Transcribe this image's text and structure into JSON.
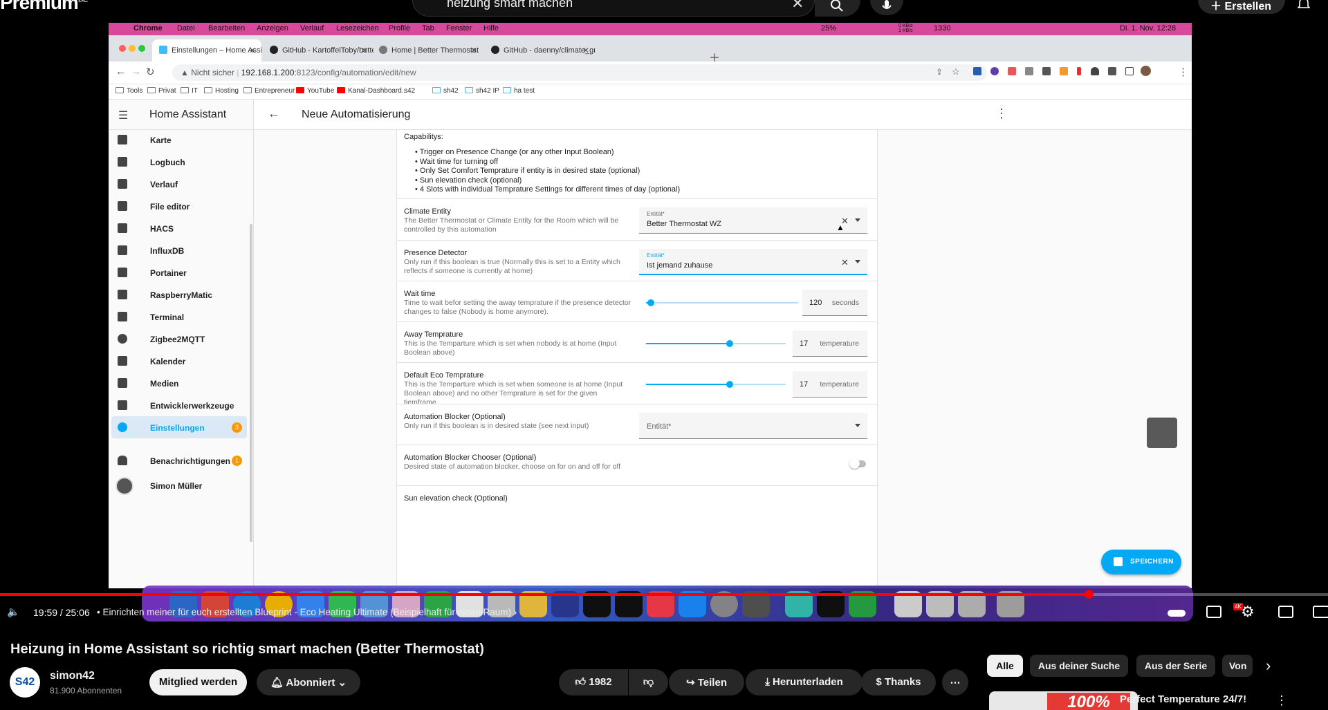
{
  "yt_header": {
    "logo": "Premium",
    "logo_region": "DE",
    "search_query": "heizung smart machen",
    "create_label": "Erstellen"
  },
  "mac_menubar": {
    "app": "Chrome",
    "items": [
      "Datei",
      "Bearbeiten",
      "Anzeigen",
      "Verlauf",
      "Lesezeichen",
      "Profile",
      "Tab",
      "Fenster",
      "Hilfe"
    ],
    "battery": "25%",
    "net_up": "0 KB/s",
    "net_down": "1 KB/s",
    "counter": "1330",
    "datetime": "Di. 1. Nov. 12:28"
  },
  "browser": {
    "tabs": [
      {
        "label": "Einstellungen – Home Assistant",
        "active": true
      },
      {
        "label": "GitHub - KartoffelToby/better_",
        "active": false
      },
      {
        "label": "Home | Better Thermostat",
        "active": false
      },
      {
        "label": "GitHub - daenny/climate_grou",
        "active": false
      }
    ],
    "security": "Nicht sicher",
    "url_host": "192.168.1.200",
    "url_path": ":8123/config/automation/edit/new",
    "bookmarks": [
      "Tools",
      "Privat",
      "IT",
      "Hosting",
      "Entrepreneur",
      "YouTube",
      "Kanal-Dashboard...",
      "s42",
      "sh42",
      "sh42 IP",
      "ha test"
    ]
  },
  "ha": {
    "app_title": "Home Assistant",
    "page_title": "Neue Automatisierung",
    "sidebar": [
      {
        "label": "Karte",
        "icon": "map-icon"
      },
      {
        "label": "Logbuch",
        "icon": "list-icon"
      },
      {
        "label": "Verlauf",
        "icon": "chart-icon"
      },
      {
        "label": "File editor",
        "icon": "wrench-icon"
      },
      {
        "label": "HACS",
        "icon": "hacs-icon"
      },
      {
        "label": "InfluxDB",
        "icon": "chart-area-icon"
      },
      {
        "label": "Portainer",
        "icon": "whale-icon"
      },
      {
        "label": "RaspberryMatic",
        "icon": "router-icon"
      },
      {
        "label": "Terminal",
        "icon": "terminal-icon"
      },
      {
        "label": "Zigbee2MQTT",
        "icon": "zigbee-icon"
      },
      {
        "label": "Kalender",
        "icon": "calendar-icon"
      },
      {
        "label": "Medien",
        "icon": "media-icon"
      },
      {
        "label": "Entwicklerwerkzeuge",
        "icon": "hammer-icon"
      },
      {
        "label": "Einstellungen",
        "icon": "gear-icon",
        "badge": "3"
      }
    ],
    "notifications": {
      "label": "Benachrichtigungen",
      "badge": "1"
    },
    "user": "Simon Müller",
    "capabilities_title": "Capabilitys:",
    "capabilities": [
      "Trigger on Presence Change (or any other Input Boolean)",
      "Wait time for turning off",
      "Only Set Comfort Temprature if entity is in desired state (optional)",
      "Sun elevation check (optional)",
      "4 Slots with individual Temprature Settings for different times of day (optional)"
    ],
    "rows": [
      {
        "title": "Climate Entity",
        "desc": "The Better Thermostat or Climate Entity for the Room which will be controlled by this automation",
        "field_label": "Entität*",
        "value": "Better Thermostat WZ"
      },
      {
        "title": "Presence Detector",
        "desc": "Only run if this boolean is true (Normally this is set to a Entity which reflects if someone is currently at home)",
        "field_label": "Entität*",
        "value": "Ist jemand zuhause"
      },
      {
        "title": "Wait time",
        "desc": "Time to wait befor setting the away temprature if the presence detector changes to false (Nobody is home anymore).",
        "value": "120",
        "unit": "seconds",
        "slider_level": 0.03
      },
      {
        "title": "Away Temprature",
        "desc": "This is the Temparture which is set when nobody is at home (Input Boolean above)",
        "value": "17",
        "unit": "temperature",
        "slider_level": 0.6
      },
      {
        "title": "Default Eco Temprature",
        "desc": "This is the Temparture which is set when someone is at home (Input Boolean above) and no other Temprature is set for the given tiemframe.",
        "value": "17",
        "unit": "temperature",
        "slider_level": 0.6
      },
      {
        "title": "Automation Blocker (Optional)",
        "desc": "Only run if this boolean is in desired state (see next input)",
        "field_label": "Entität*"
      },
      {
        "title": "Automation Blocker Chooser (Optional)",
        "desc": "Desired state of automation blocker, choose on for on and off for off"
      },
      {
        "title": "Sun elevation check (Optional)"
      }
    ],
    "save_label": "SPEICHERN"
  },
  "player": {
    "time": "19:59 / 25:06",
    "chapter": "• Einrichten meiner für euch erstellten Blueprint - Eco Heating Ultimate (Beispielhaft für einen Raum)",
    "progress": 0.82,
    "quality_badge": "4K"
  },
  "video": {
    "title": "Heizung in Home Assistant so richtig smart machen (Better Thermostat)",
    "channel": "simon42",
    "channel_logo": "S42",
    "subscribers": "81.900 Abonnenten",
    "member_btn": "Mitglied werden",
    "subscribed_btn": "Abonniert",
    "likes": "1982",
    "share": "Teilen",
    "download": "Herunterladen",
    "thanks": "Thanks",
    "chips": [
      "Alle",
      "Aus deiner Suche",
      "Aus der Serie",
      "Von"
    ],
    "rec_title": "Perfect Temperature 24/7!",
    "rec_thumb_text": "100%"
  }
}
